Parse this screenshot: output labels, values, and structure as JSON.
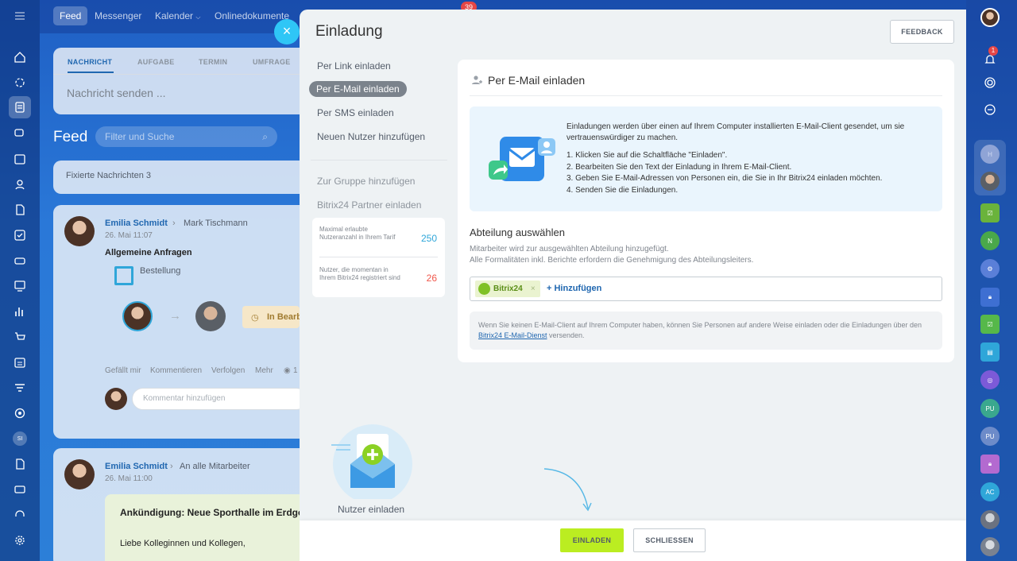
{
  "topbar": {
    "feed": "Feed",
    "messenger": "Messenger",
    "calendar": "Kalender",
    "documents": "Onlinedokumente",
    "badge": "39"
  },
  "composer": {
    "tabs": [
      "NACHRICHT",
      "AUFGABE",
      "TERMIN",
      "UMFRAGE"
    ],
    "placeholder": "Nachricht senden ..."
  },
  "feed": {
    "title": "Feed",
    "search_placeholder": "Filter und Suche",
    "pinned": "Fixierte Nachrichten  3",
    "post1": {
      "author": "Emilia Schmidt",
      "recipient": "Mark Tischmann",
      "date": "26. Mai 11:07",
      "title": "Allgemeine Anfragen",
      "attachment": "Bestellung",
      "status": "In Bearb",
      "actions": [
        "Gefällt mir",
        "Kommentieren",
        "Verfolgen",
        "Mehr"
      ],
      "views": "1",
      "comment_placeholder": "Kommentar hinzufügen"
    },
    "post2": {
      "author": "Emilia Schmidt",
      "recipient": "An alle Mitarbeiter",
      "date": "26. Mai 11:00",
      "title": "Ankündigung: Neue Sporthalle im Erdgesc",
      "greeting": "Liebe Kolleginnen und Kollegen,"
    }
  },
  "slider": {
    "title": "Einladung",
    "feedback": "FEEDBACK",
    "menu": {
      "link": "Per Link einladen",
      "email": "Per E-Mail einladen",
      "sms": "Per SMS einladen",
      "new_user": "Neuen Nutzer hinzufügen",
      "group": "Zur Gruppe hinzufügen",
      "partner": "Bitrix24 Partner einladen"
    },
    "limits": {
      "max_label": "Maximal erlaubte Nutzeranzahl in Ihrem Tarif",
      "max_value": "250",
      "current_label": "Nutzer, die momentan in Ihrem Bitrix24 registriert sind",
      "current_value": "26"
    },
    "card": {
      "title": "Per E-Mail einladen",
      "info_lead": "Einladungen werden über einen auf Ihrem Computer installierten E-Mail-Client gesendet, um sie vertrauenswürdiger zu machen.",
      "steps": [
        "1. Klicken Sie auf die Schaltfläche \"Einladen\".",
        "2. Bearbeiten Sie den Text der Einladung in Ihrem E-Mail-Client.",
        "3. Geben Sie E-Mail-Adressen von Personen ein, die Sie in Ihr Bitrix24 einladen möchten.",
        "4. Senden Sie die Einladungen."
      ],
      "dept_title": "Abteilung auswählen",
      "dept_sub1": "Mitarbeiter wird zur ausgewählten Abteilung hinzugefügt.",
      "dept_sub2": "Alle Formalitäten inkl. Berichte erfordern die Genehmigung des Abteilungsleiters.",
      "dept_tag": "Bitrix24",
      "add_label": "+ Hinzufügen",
      "note_before": "Wenn Sie keinen E-Mail-Client auf Ihrem Computer haben, können Sie Personen auf andere Weise einladen oder die Einladungen über den ",
      "note_link": "Bitrix24 E-Mail-Dienst",
      "note_after": " versenden."
    },
    "invite_label": "Nutzer einladen",
    "btn_invite": "EINLADEN",
    "btn_close": "SCHLIESSEN"
  },
  "right_rail": {
    "bell_badge": "1",
    "initials": [
      "H",
      "N",
      "PU",
      "PU",
      "AC"
    ]
  },
  "colors": {
    "accent_blue": "#2067b0",
    "invite_green": "#bbed21",
    "limit_max": "#2fa6d9",
    "limit_current": "#f0564a"
  },
  "left_rail": {
    "si": "SI"
  }
}
